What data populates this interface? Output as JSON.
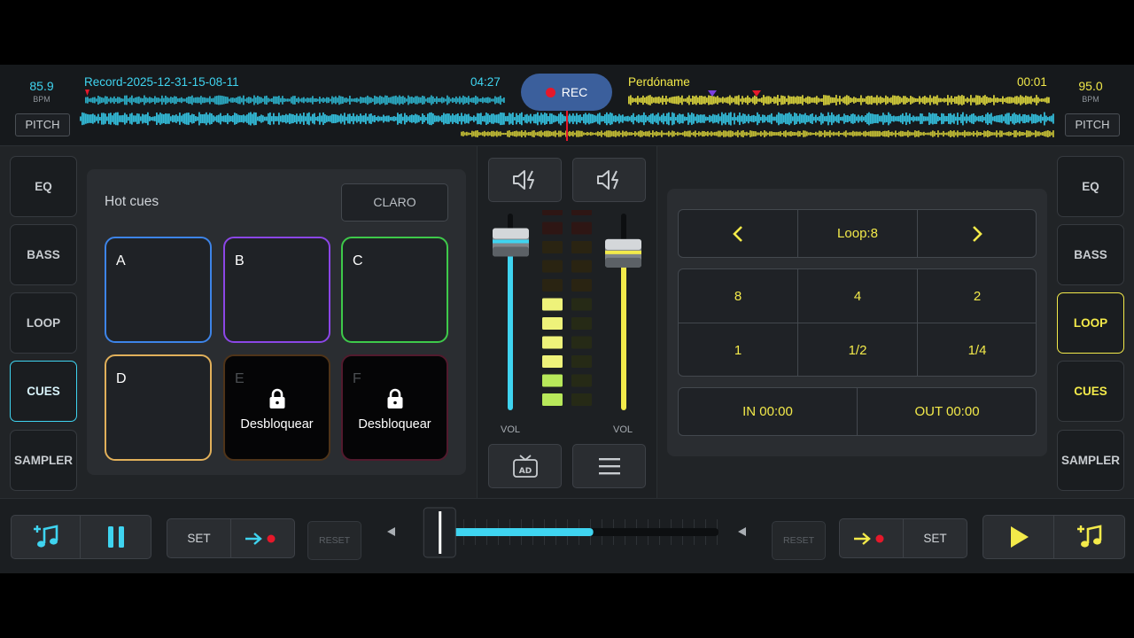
{
  "deck_left": {
    "bpm": "85.9",
    "bpm_unit": "BPM",
    "pitch_label": "PITCH",
    "track": "Record-2025-12-31-15-08-11",
    "time": "04:27",
    "color": "#3fd4f0"
  },
  "deck_right": {
    "bpm": "95.0",
    "bpm_unit": "BPM",
    "pitch_label": "PITCH",
    "track": "Perdóname",
    "time": "00:01",
    "color": "#f3ea4a"
  },
  "record": {
    "label": "REC",
    "record_color": "#e6182a"
  },
  "left_tabs": [
    "EQ",
    "BASS",
    "LOOP",
    "CUES",
    "SAMPLER"
  ],
  "right_tabs": [
    "EQ",
    "BASS",
    "LOOP",
    "CUES",
    "SAMPLER"
  ],
  "left_active_tab": "CUES",
  "right_active_tab": "LOOP",
  "hot_cues": {
    "title": "Hot cues",
    "clear_label": "CLARO",
    "pads": [
      {
        "label": "A",
        "color": "#3d84e8",
        "locked": false
      },
      {
        "label": "B",
        "color": "#8b46e6",
        "locked": false
      },
      {
        "label": "C",
        "color": "#3ec94a",
        "locked": false
      },
      {
        "label": "D",
        "color": "#e1b05a",
        "locked": false
      },
      {
        "label": "E",
        "color": "#4f3419",
        "locked": true,
        "unlock_label": "Desbloquear"
      },
      {
        "label": "F",
        "color": "#521a2d",
        "locked": true,
        "unlock_label": "Desbloquear"
      }
    ]
  },
  "mixer": {
    "left_vol_label": "VOL",
    "right_vol_label": "VOL",
    "left_volume": 0.92,
    "right_volume": 0.86,
    "vu_left_lit_segments": 6,
    "vu_right_lit_segments": 0,
    "vu_segments": 12,
    "icons": [
      "speaker-flash-icon",
      "speaker-flash-icon",
      "tv-ad-icon",
      "menu-icon"
    ]
  },
  "loop": {
    "prev_icon": "chevron-left-icon",
    "next_icon": "chevron-right-icon",
    "loop_label": "Loop:8",
    "sizes": [
      "8",
      "4",
      "2",
      "1",
      "1/2",
      "1/4"
    ],
    "in_label": "IN 00:00",
    "out_label": "OUT 00:00"
  },
  "transport_left": {
    "add_music_icon": "add-music-icon",
    "pause_icon": "pause-icon",
    "set_label": "SET",
    "reset_label": "RESET"
  },
  "transport_right": {
    "add_music_icon": "add-music-icon",
    "play_icon": "play-icon",
    "set_label": "SET",
    "reset_label": "RESET"
  },
  "crossfader": {
    "position": 0.04,
    "progress": 0.44
  }
}
